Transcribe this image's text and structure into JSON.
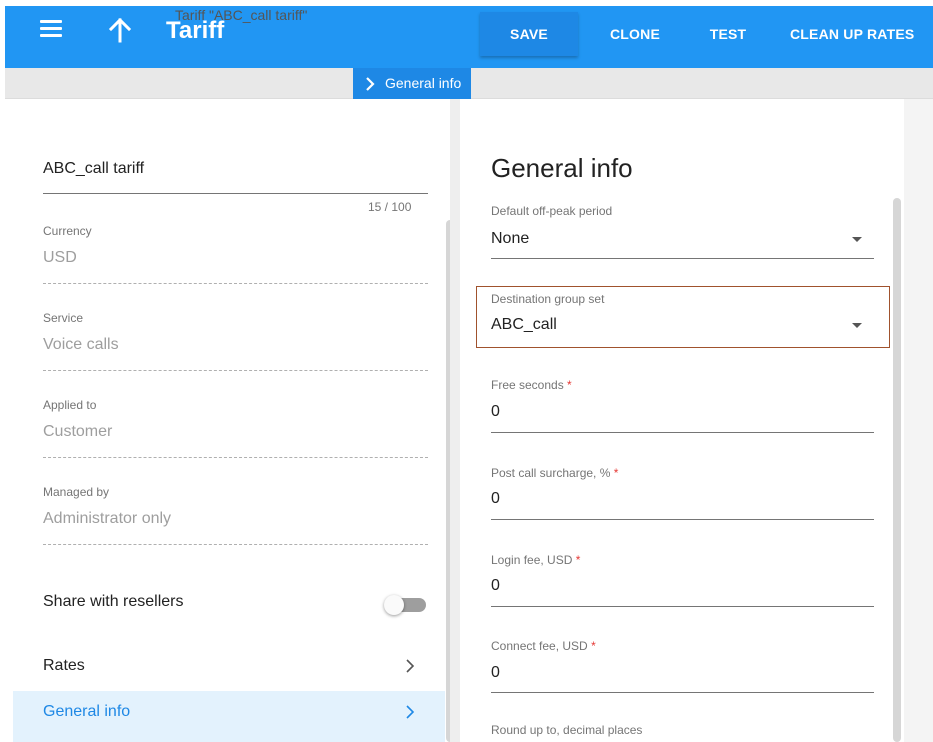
{
  "header": {
    "title": "Tariff",
    "buttons": {
      "save": "SAVE",
      "clone": "CLONE",
      "test": "TEST",
      "clean_up_rates": "CLEAN UP RATES"
    }
  },
  "breadcrumb": {
    "prev": "Tariff \"ABC_call tariff\"",
    "current": "General info"
  },
  "left": {
    "name": {
      "value": "ABC_call tariff",
      "counter": "15 / 100"
    },
    "fields": [
      {
        "label": "Currency",
        "value": "USD"
      },
      {
        "label": "Service",
        "value": "Voice calls"
      },
      {
        "label": "Applied to",
        "value": "Customer"
      },
      {
        "label": "Managed by",
        "value": "Administrator only"
      }
    ],
    "share": {
      "label": "Share with resellers",
      "enabled": false
    },
    "nav": [
      {
        "label": "Rates",
        "active": false
      },
      {
        "label": "General info",
        "active": true
      }
    ]
  },
  "panel": {
    "title": "General info",
    "fields": {
      "off_peak": {
        "label": "Default off-peak period",
        "value": "None"
      },
      "dest_group": {
        "label": "Destination group set",
        "value": "ABC_call"
      },
      "free_seconds": {
        "label": "Free seconds",
        "req": "*",
        "value": "0"
      },
      "post_call": {
        "label": "Post call surcharge, %",
        "req": "*",
        "value": "0"
      },
      "login_fee": {
        "label": "Login fee, USD",
        "req": "*",
        "value": "0"
      },
      "connect_fee": {
        "label": "Connect fee, USD",
        "req": "*",
        "value": "0"
      },
      "round_up": {
        "label": "Round up to, decimal places"
      }
    }
  },
  "colors": {
    "primary": "#2196f3",
    "primary_dark": "#1e88e5",
    "highlight_border": "#a0522d",
    "required": "#e53935"
  }
}
